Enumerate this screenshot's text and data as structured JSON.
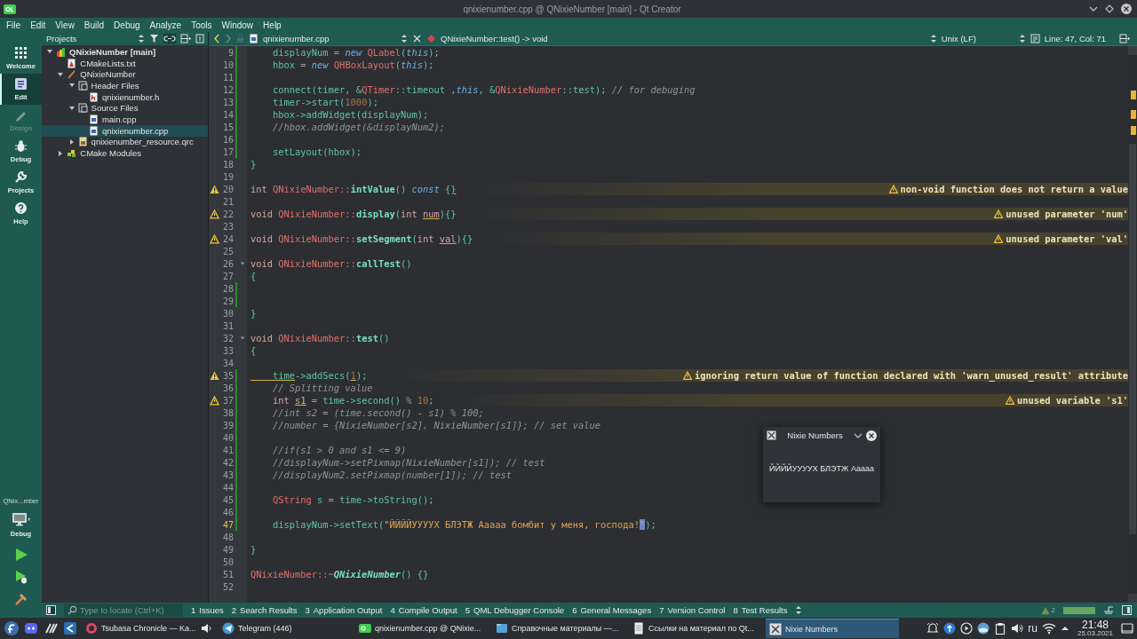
{
  "window": {
    "title": "qnixienumber.cpp @ QNixieNumber [main] - Qt Creator"
  },
  "menu": [
    "File",
    "Edit",
    "View",
    "Build",
    "Debug",
    "Analyze",
    "Tools",
    "Window",
    "Help"
  ],
  "modes": [
    {
      "label": "Welcome",
      "selected": false,
      "disabled": false
    },
    {
      "label": "Edit",
      "selected": true,
      "disabled": false
    },
    {
      "label": "Design",
      "selected": false,
      "disabled": true
    },
    {
      "label": "Debug",
      "selected": false,
      "disabled": false
    },
    {
      "label": "Projects",
      "selected": false,
      "disabled": false
    },
    {
      "label": "Help",
      "selected": false,
      "disabled": false
    }
  ],
  "kit": {
    "name": "QNix...mber",
    "build": "Debug"
  },
  "projects": {
    "title": "Projects",
    "tree": [
      {
        "label": "QNixieNumber [main]",
        "kind": "project",
        "expanded": true,
        "selected": false,
        "children": [
          {
            "label": "CMakeLists.txt",
            "kind": "cmake",
            "selected": false
          },
          {
            "label": "QNixieNumber",
            "kind": "target",
            "expanded": true,
            "selected": false,
            "children": [
              {
                "label": "Header Files",
                "kind": "folder",
                "expanded": true,
                "selected": false,
                "children": [
                  {
                    "label": "qnixienumber.h",
                    "kind": "header",
                    "selected": false
                  }
                ]
              },
              {
                "label": "Source Files",
                "kind": "folder",
                "expanded": true,
                "selected": false,
                "children": [
                  {
                    "label": "main.cpp",
                    "kind": "source",
                    "selected": false
                  },
                  {
                    "label": "qnixienumber.cpp",
                    "kind": "source",
                    "selected": true
                  }
                ]
              },
              {
                "label": "qnixienumber_resource.qrc",
                "kind": "resource",
                "expanded": false,
                "selected": false
              }
            ]
          },
          {
            "label": "CMake Modules",
            "kind": "modules",
            "expanded": false,
            "selected": false
          }
        ]
      }
    ]
  },
  "editor": {
    "file": "qnixienumber.cpp",
    "symbol": "QNixieNumber::test() -> void",
    "line_endings": "Unix (LF)",
    "position": "Line: 47, Col: 71",
    "lines": [
      {
        "number": "9",
        "changed": true,
        "current": false,
        "foldable": false,
        "tokens": [
          {
            "text": "    displayNum",
            "kind": "plain"
          },
          {
            "text": " = ",
            "kind": "op"
          },
          {
            "text": "new",
            "kind": "kw"
          },
          {
            "text": " QLabel",
            "kind": "type"
          },
          {
            "text": "(",
            "kind": "plain"
          },
          {
            "text": "this",
            "kind": "kw"
          },
          {
            "text": ");",
            "kind": "plain"
          }
        ]
      },
      {
        "number": "10",
        "changed": true,
        "current": false,
        "foldable": false,
        "tokens": [
          {
            "text": "    hbox",
            "kind": "plain"
          },
          {
            "text": " = ",
            "kind": "op"
          },
          {
            "text": "new",
            "kind": "kw"
          },
          {
            "text": " QHBoxLayout",
            "kind": "type"
          },
          {
            "text": "(",
            "kind": "plain"
          },
          {
            "text": "this",
            "kind": "kw"
          },
          {
            "text": ");",
            "kind": "plain"
          }
        ]
      },
      {
        "number": "11",
        "changed": true,
        "current": false,
        "foldable": false
      },
      {
        "number": "12",
        "changed": true,
        "current": false,
        "foldable": false,
        "tokens": [
          {
            "text": "    connect(timer, &",
            "kind": "plain"
          },
          {
            "text": "QTimer",
            "kind": "type"
          },
          {
            "text": "::timeout ,",
            "kind": "plain"
          },
          {
            "text": "this",
            "kind": "kw"
          },
          {
            "text": ", &",
            "kind": "plain"
          },
          {
            "text": "QNixieNumber",
            "kind": "type"
          },
          {
            "text": "::test); ",
            "kind": "plain"
          },
          {
            "text": "// for debuging",
            "kind": "comment"
          }
        ]
      },
      {
        "number": "13",
        "changed": true,
        "current": false,
        "foldable": false,
        "tokens": [
          {
            "text": "    timer->start(",
            "kind": "plain"
          },
          {
            "text": "1000",
            "kind": "num"
          },
          {
            "text": ");",
            "kind": "plain"
          }
        ]
      },
      {
        "number": "14",
        "changed": true,
        "current": false,
        "foldable": false,
        "tokens": [
          {
            "text": "    hbox->addWidget(displayNum);",
            "kind": "plain"
          }
        ]
      },
      {
        "number": "15",
        "changed": true,
        "current": false,
        "foldable": false,
        "tokens": [
          {
            "text": "    //hbox.addWidget(&displayNum2);",
            "kind": "comment"
          }
        ]
      },
      {
        "number": "16",
        "changed": true,
        "current": false,
        "foldable": false
      },
      {
        "number": "17",
        "changed": true,
        "current": false,
        "foldable": false,
        "tokens": [
          {
            "text": "    setLayout(hbox);",
            "kind": "plain"
          }
        ]
      },
      {
        "number": "18",
        "changed": false,
        "current": false,
        "foldable": false,
        "tokens": [
          {
            "text": "}",
            "kind": "plain"
          }
        ]
      },
      {
        "number": "19",
        "changed": false,
        "current": false,
        "foldable": false
      },
      {
        "number": "20",
        "changed": false,
        "current": false,
        "foldable": false,
        "tokens": [
          {
            "text": "int ",
            "kind": "prim"
          },
          {
            "text": "QNixieNumber::",
            "kind": "type"
          },
          {
            "text": "intValue",
            "kind": "decl"
          },
          {
            "text": "() ",
            "kind": "plain"
          },
          {
            "text": "const",
            "kind": "kw"
          },
          {
            "text": " {",
            "kind": "plain"
          },
          {
            "text": "}",
            "kind": "flagged"
          }
        ],
        "warning": {
          "text": "non-void function does not return a value",
          "filled": true
        }
      },
      {
        "number": "21",
        "changed": false,
        "current": false,
        "foldable": false
      },
      {
        "number": "22",
        "changed": false,
        "current": false,
        "foldable": false,
        "tokens": [
          {
            "text": "void ",
            "kind": "prim"
          },
          {
            "text": "QNixieNumber::",
            "kind": "type"
          },
          {
            "text": "display",
            "kind": "decl"
          },
          {
            "text": "(",
            "kind": "plain"
          },
          {
            "text": "int ",
            "kind": "prim"
          },
          {
            "text": "num",
            "kind": "flagged_param"
          },
          {
            "text": "){}",
            "kind": "plain"
          }
        ],
        "warning": {
          "text": "unused parameter 'num'",
          "filled": false
        }
      },
      {
        "number": "23",
        "changed": false,
        "current": false,
        "foldable": false
      },
      {
        "number": "24",
        "changed": false,
        "current": false,
        "foldable": false,
        "tokens": [
          {
            "text": "void ",
            "kind": "prim"
          },
          {
            "text": "QNixieNumber::",
            "kind": "type"
          },
          {
            "text": "setSegment",
            "kind": "decl"
          },
          {
            "text": "(",
            "kind": "plain"
          },
          {
            "text": "int ",
            "kind": "prim"
          },
          {
            "text": "val",
            "kind": "flagged_param"
          },
          {
            "text": "){}",
            "kind": "plain"
          }
        ],
        "warning": {
          "text": "unused parameter 'val'",
          "filled": false
        }
      },
      {
        "number": "25",
        "changed": false,
        "current": false,
        "foldable": false
      },
      {
        "number": "26",
        "changed": false,
        "current": false,
        "foldable": true,
        "tokens": [
          {
            "text": "void ",
            "kind": "prim"
          },
          {
            "text": "QNixieNumber::",
            "kind": "type"
          },
          {
            "text": "callTest",
            "kind": "decl"
          },
          {
            "text": "()",
            "kind": "plain"
          }
        ]
      },
      {
        "number": "27",
        "changed": false,
        "current": false,
        "foldable": false,
        "tokens": [
          {
            "text": "{",
            "kind": "plain"
          }
        ]
      },
      {
        "number": "28",
        "changed": true,
        "current": false,
        "foldable": false
      },
      {
        "number": "29",
        "changed": true,
        "current": false,
        "foldable": false
      },
      {
        "number": "30",
        "changed": false,
        "current": false,
        "foldable": false,
        "tokens": [
          {
            "text": "}",
            "kind": "plain"
          }
        ]
      },
      {
        "number": "31",
        "changed": false,
        "current": false,
        "foldable": false
      },
      {
        "number": "32",
        "changed": false,
        "current": false,
        "foldable": true,
        "tokens": [
          {
            "text": "void ",
            "kind": "prim"
          },
          {
            "text": "QNixieNumber::",
            "kind": "type"
          },
          {
            "text": "test",
            "kind": "decl"
          },
          {
            "text": "()",
            "kind": "plain"
          }
        ]
      },
      {
        "number": "33",
        "changed": false,
        "current": false,
        "foldable": false,
        "tokens": [
          {
            "text": "{",
            "kind": "plain"
          }
        ]
      },
      {
        "number": "34",
        "changed": false,
        "current": false,
        "foldable": false
      },
      {
        "number": "35",
        "changed": true,
        "current": false,
        "foldable": false,
        "tokens": [
          {
            "text": "    time",
            "kind": "flagged"
          },
          {
            "text": "->addSecs(",
            "kind": "plain"
          },
          {
            "text": "1",
            "kind": "flagged_num"
          },
          {
            "text": ");",
            "kind": "plain"
          }
        ],
        "warning": {
          "text": "ignoring return value of function declared with 'warn_unused_result' attribute",
          "filled": true
        }
      },
      {
        "number": "36",
        "changed": true,
        "current": false,
        "foldable": false,
        "tokens": [
          {
            "text": "    // Splitting value",
            "kind": "comment"
          }
        ]
      },
      {
        "number": "37",
        "changed": true,
        "current": false,
        "foldable": false,
        "tokens": [
          {
            "text": "    int ",
            "kind": "prim"
          },
          {
            "text": "s1",
            "kind": "flagged_param"
          },
          {
            "text": " = ",
            "kind": "op"
          },
          {
            "text": "time->second() ",
            "kind": "plain"
          },
          {
            "text": "% ",
            "kind": "op"
          },
          {
            "text": "10",
            "kind": "num"
          },
          {
            "text": ";",
            "kind": "plain"
          }
        ],
        "warning": {
          "text": "unused variable 's1'",
          "filled": false
        }
      },
      {
        "number": "38",
        "changed": true,
        "current": false,
        "foldable": false,
        "tokens": [
          {
            "text": "    //int s2 = (time.second() - s1) % 100;",
            "kind": "comment"
          }
        ]
      },
      {
        "number": "39",
        "changed": true,
        "current": false,
        "foldable": false,
        "tokens": [
          {
            "text": "    //number = {NixieNumber[s2], NixieNumber[s1]}; // set value",
            "kind": "comment"
          }
        ]
      },
      {
        "number": "40",
        "changed": true,
        "current": false,
        "foldable": false
      },
      {
        "number": "41",
        "changed": true,
        "current": false,
        "foldable": false,
        "tokens": [
          {
            "text": "    //if(s1 > 0 and s1 <= 9)",
            "kind": "comment"
          }
        ]
      },
      {
        "number": "42",
        "changed": true,
        "current": false,
        "foldable": false,
        "tokens": [
          {
            "text": "    //displayNum->setPixmap(NixieNumber[s1]); // test",
            "kind": "comment"
          }
        ]
      },
      {
        "number": "43",
        "changed": true,
        "current": false,
        "foldable": false,
        "tokens": [
          {
            "text": "    //displayNum2.setPixmap(number[1]); // test",
            "kind": "comment"
          }
        ]
      },
      {
        "number": "44",
        "changed": true,
        "current": false,
        "foldable": false
      },
      {
        "number": "45",
        "changed": true,
        "current": false,
        "foldable": false,
        "tokens": [
          {
            "text": "    QString",
            "kind": "type"
          },
          {
            "text": " s ",
            "kind": "plain"
          },
          {
            "text": "= ",
            "kind": "op"
          },
          {
            "text": "time->toString();",
            "kind": "plain"
          }
        ]
      },
      {
        "number": "46",
        "changed": true,
        "current": false,
        "foldable": false
      },
      {
        "number": "47",
        "changed": true,
        "current": true,
        "foldable": false,
        "tokens": [
          {
            "text": "    displayNum->setText(",
            "kind": "plain"
          },
          {
            "text": "\"ЙЙЙЙУУУУХ БЛЭТЖ Ааааа бомбит у меня, господа!",
            "kind": "str"
          },
          {
            "text": "\"",
            "kind": "cursor"
          },
          {
            "text": ");",
            "kind": "plain"
          }
        ]
      },
      {
        "number": "48",
        "changed": false,
        "current": false,
        "foldable": false
      },
      {
        "number": "49",
        "changed": false,
        "current": false,
        "foldable": false,
        "tokens": [
          {
            "text": "}",
            "kind": "plain"
          }
        ]
      },
      {
        "number": "50",
        "changed": false,
        "current": false,
        "foldable": false
      },
      {
        "number": "51",
        "changed": false,
        "current": false,
        "foldable": false,
        "tokens": [
          {
            "text": "QNixieNumber::~",
            "kind": "type"
          },
          {
            "text": "QNixieNumber",
            "kind": "decl_italic"
          },
          {
            "text": "() {}",
            "kind": "plain"
          }
        ]
      },
      {
        "number": "52",
        "changed": false,
        "current": false,
        "foldable": false
      }
    ]
  },
  "app_window": {
    "title": "Nixie Numbers",
    "label": "ЙЙЙЙУУУУХ БЛЭТЖ Ааааа"
  },
  "output_bar": {
    "locate": {
      "placeholder": "Type to locate (Ctrl+K)"
    },
    "tabs": [
      {
        "number": "1",
        "label": "Issues"
      },
      {
        "number": "2",
        "label": "Search Results"
      },
      {
        "number": "3",
        "label": "Application Output"
      },
      {
        "number": "4",
        "label": "Compile Output"
      },
      {
        "number": "5",
        "label": "QML Debugger Console"
      },
      {
        "number": "6",
        "label": "General Messages"
      },
      {
        "number": "7",
        "label": "Version Control"
      },
      {
        "number": "8",
        "label": "Test Results"
      }
    ],
    "warning_count": "2",
    "progress": {
      "level": 1
    }
  },
  "taskbar": {
    "tasks": [
      {
        "label": "Tsubasa Chronicle — Ka...",
        "kind": "browser",
        "audio": true,
        "selected": false
      },
      {
        "label": "Telegram (446)",
        "kind": "telegram",
        "audio": false,
        "selected": false
      },
      {
        "label": "qnixienumber.cpp @ QNixie...",
        "kind": "qt",
        "audio": false,
        "selected": false
      },
      {
        "label": "Справочные материалы —...",
        "kind": "folder",
        "audio": false,
        "selected": false
      },
      {
        "label": "Ссылки на материал по Qt...",
        "kind": "document",
        "audio": false,
        "selected": false
      },
      {
        "label": "Nixie Numbers",
        "kind": "app",
        "audio": false,
        "selected": true
      }
    ],
    "keyboard_layout": "ru",
    "time": "21:48",
    "date": "25.03.2021"
  }
}
